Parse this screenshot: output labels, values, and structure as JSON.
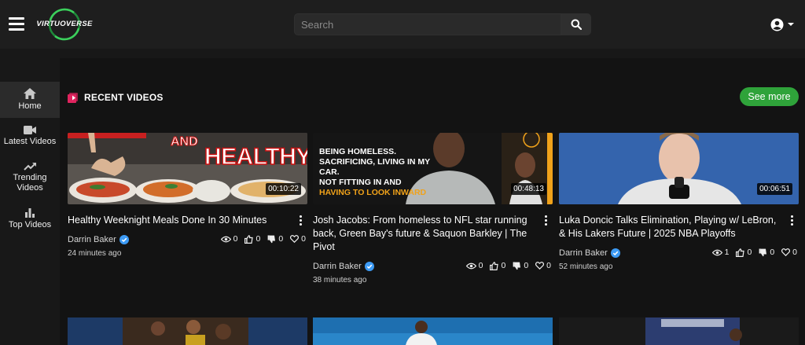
{
  "header": {
    "logo_text": "VIRTUOVERSE",
    "search_placeholder": "Search"
  },
  "sidebar": {
    "items": [
      {
        "label": "Home",
        "icon": "home-icon"
      },
      {
        "label": "Latest Videos",
        "icon": "video-camera-icon"
      },
      {
        "label": "Trending Videos",
        "icon": "trending-icon"
      },
      {
        "label": "Top Videos",
        "icon": "bar-chart-icon"
      }
    ]
  },
  "section": {
    "title": "RECENT VIDEOS",
    "see_more": "See more"
  },
  "videos": [
    {
      "title": "Healthy Weeknight Meals Done In 30 Minutes",
      "duration": "00:10:22",
      "author": "Darrin Baker",
      "views": "0",
      "likes": "0",
      "dislikes": "0",
      "favorites": "0",
      "age": "24 minutes ago",
      "thumb_text_1": "AND",
      "thumb_text_2": "HEALTHY"
    },
    {
      "title": "Josh Jacobs: From homeless to NFL star running back, Green Bay's future & Saquon Barkley | The Pivot",
      "duration": "00:48:13",
      "author": "Darrin Baker",
      "views": "0",
      "likes": "0",
      "dislikes": "0",
      "favorites": "0",
      "age": "38 minutes ago",
      "thumb_text_lines": [
        "BEING HOMELESS.",
        "SACRIFICING, LIVING IN MY CAR.",
        "NOT FITTING IN AND"
      ],
      "thumb_text_highlight": "HAVING TO LOOK INWARD"
    },
    {
      "title": "Luka Doncic Talks Elimination, Playing w/ LeBron, & His Lakers Future | 2025 NBA Playoffs",
      "duration": "00:06:51",
      "author": "Darrin Baker",
      "views": "1",
      "likes": "0",
      "dislikes": "0",
      "favorites": "0",
      "age": "52 minutes ago"
    }
  ],
  "colors": {
    "accent_green": "#2fa33a",
    "verified_blue": "#3d9bf5",
    "section_icon_red": "#e0245e"
  }
}
